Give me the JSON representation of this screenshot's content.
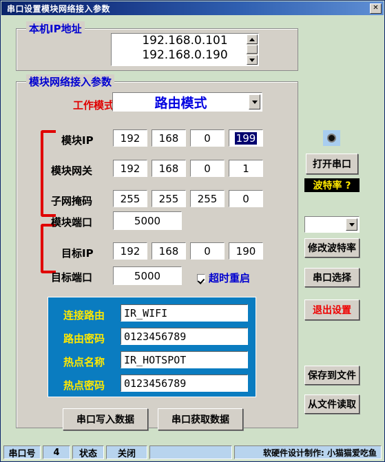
{
  "window": {
    "title": "串口设置模块网络接入参数",
    "close_label": "✕"
  },
  "local_ip_group": {
    "legend": "本机IP地址",
    "items": [
      "192.168.0.101",
      "192.168.0.190"
    ]
  },
  "module_group": {
    "legend": "模块网络接入参数",
    "work_mode": {
      "label": "工作模式",
      "value": "路由模式"
    },
    "module_ip": {
      "label": "模块IP",
      "octets": [
        "192",
        "168",
        "0",
        "199"
      ],
      "selected_index": 3
    },
    "module_gateway": {
      "label": "模块网关",
      "octets": [
        "192",
        "168",
        "0",
        "1"
      ]
    },
    "subnet_mask": {
      "label": "子网掩码",
      "octets": [
        "255",
        "255",
        "255",
        "0"
      ]
    },
    "module_port": {
      "label": "模块端口",
      "value": "5000"
    },
    "target_ip": {
      "label": "目标IP",
      "octets": [
        "192",
        "168",
        "0",
        "190"
      ]
    },
    "target_port": {
      "label": "目标端口",
      "value": "5000"
    },
    "timeout_restart": {
      "label": "超时重启",
      "checked": true
    },
    "wifi_panel": {
      "router_ssid": {
        "label": "连接路由",
        "value": "IR_WIFI"
      },
      "router_password": {
        "label": "路由密码",
        "value": "0123456789"
      },
      "hotspot_name": {
        "label": "热点名称",
        "value": "IR_HOTSPOT"
      },
      "hotspot_password": {
        "label": "热点密码",
        "value": "0123456789"
      }
    },
    "write_button": "串口写入数据",
    "read_button": "串口获取数据"
  },
  "side_panel": {
    "open_port_button": "打开串口",
    "baud_label": "波特率 ?",
    "baud_combo_value": "",
    "change_baud_button": "修改波特率",
    "select_port_button": "串口选择",
    "exit_button": "退出设置",
    "save_file_button": "保存到文件",
    "load_file_button": "从文件读取"
  },
  "status_bar": {
    "port_label": "串口号",
    "port_value": "4",
    "state_label": "状态",
    "state_value": "关闭",
    "blank_value": "",
    "credit": "软硬件设计制作:  小猫猫爱吃鱼"
  }
}
